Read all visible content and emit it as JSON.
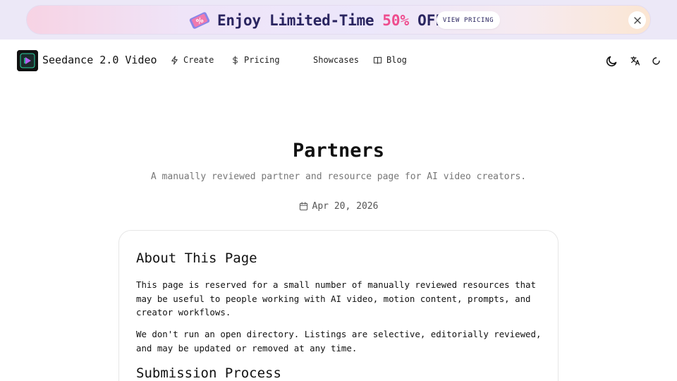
{
  "banner": {
    "prefix": "Enjoy Limited-Time",
    "highlight": "50%",
    "suffix": "OFF!",
    "cta_label": "VIEW PRICING",
    "icons": {
      "tag": "discount-tag-icon",
      "sparkle": "sparkle-icon",
      "close": "close-icon"
    },
    "colors": {
      "text": "#2a2560",
      "highlight": "#ee4d8e"
    }
  },
  "nav": {
    "brand": "Seedance 2.0 Video",
    "items": [
      {
        "label": "Create",
        "icon": "lightning-icon"
      },
      {
        "label": "Pricing",
        "icon": "dollar-icon"
      },
      {
        "label": "Showcases",
        "icon": ""
      },
      {
        "label": "Blog",
        "icon": "book-icon"
      }
    ],
    "right_icons": [
      "moon-icon",
      "translate-icon",
      "loading-icon"
    ]
  },
  "hero": {
    "title": "Partners",
    "subtitle": "A manually reviewed partner and resource page for AI video creators.",
    "date": "Apr 20, 2026"
  },
  "card": {
    "about_heading": "About This Page",
    "about_p1": "This page is reserved for a small number of manually reviewed resources that may be useful to people working with AI video, motion content, prompts, and creator workflows.",
    "about_p2": "We don't run an open directory. Listings are selective, editorially reviewed, and may be updated or removed at any time.",
    "submission_heading": "Submission Process"
  }
}
